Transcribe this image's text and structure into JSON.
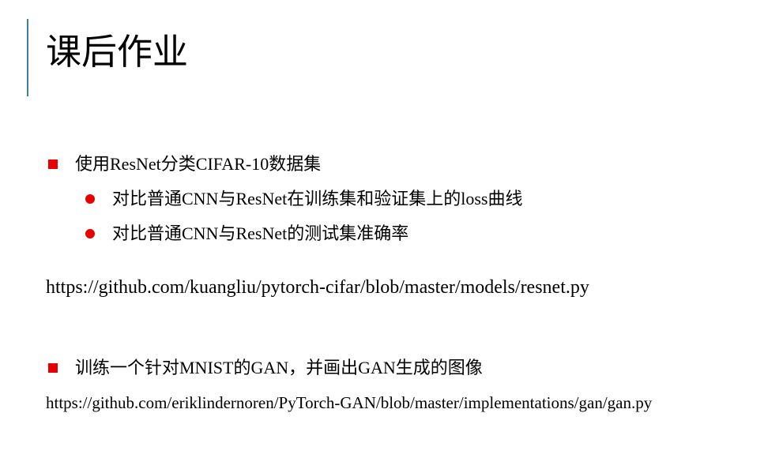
{
  "slide": {
    "title": "课后作业",
    "accent_color": "#3e7d98",
    "bullet_color": "#e60000"
  },
  "tasks": [
    {
      "text": "使用ResNet分类CIFAR-10数据集",
      "subitems": [
        "对比普通CNN与ResNet在训练集和验证集上的loss曲线",
        "对比普通CNN与ResNet的测试集准确率"
      ],
      "link": "https://github.com/kuangliu/pytorch-cifar/blob/master/models/resnet.py"
    },
    {
      "text": "训练一个针对MNIST的GAN，并画出GAN生成的图像",
      "link": "https://github.com/eriklindernoren/PyTorch-GAN/blob/master/implementations/gan/gan.py"
    }
  ]
}
